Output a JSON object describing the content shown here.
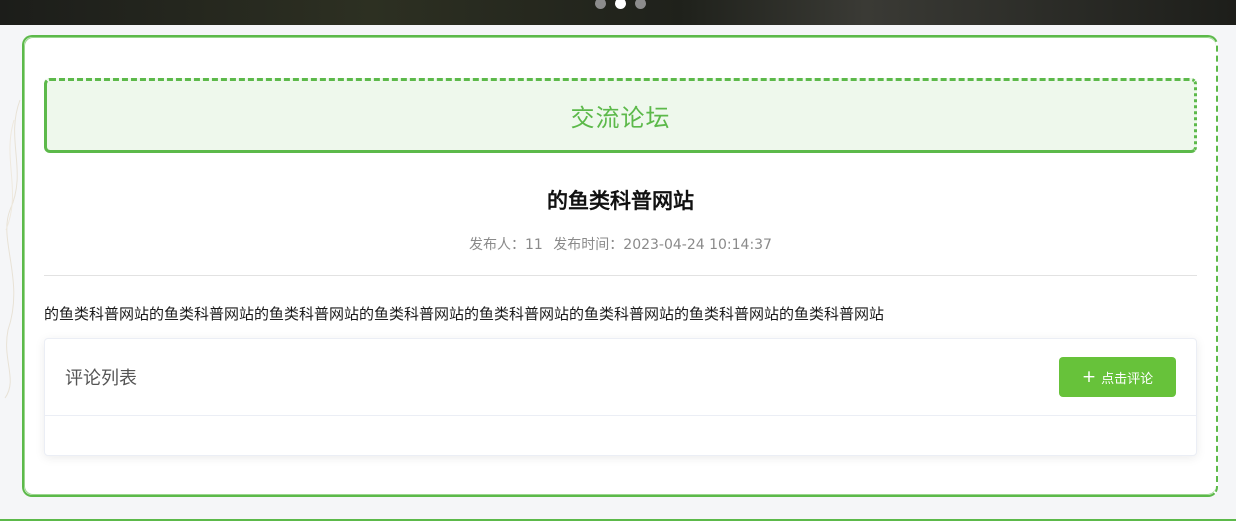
{
  "carousel": {
    "slides": 3,
    "active_index": 1
  },
  "forum": {
    "heading": "交流论坛"
  },
  "post": {
    "title": "的鱼类科普网站",
    "publisher_label": "发布人：11",
    "publish_time_label": "发布时间：2023-04-24 10:14:37",
    "body": "的鱼类科普网站的鱼类科普网站的鱼类科普网站的鱼类科普网站的鱼类科普网站的鱼类科普网站的鱼类科普网站的鱼类科普网站"
  },
  "comments": {
    "title": "评论列表",
    "add_button_label": "点击评论",
    "add_button_icon": "plus-icon"
  },
  "colors": {
    "accent": "#5cb94a",
    "button": "#67c23a",
    "title_bg": "#eef8ec"
  }
}
